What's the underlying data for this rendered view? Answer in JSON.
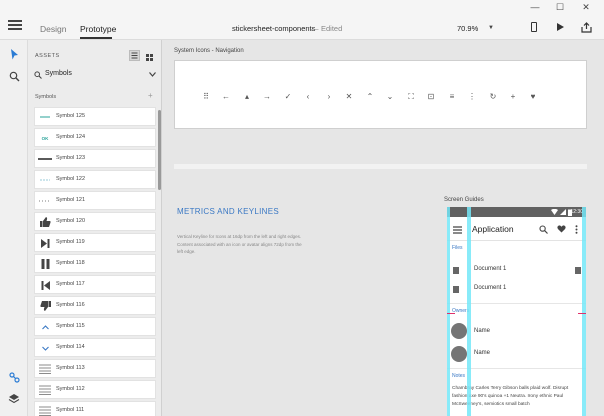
{
  "window": {
    "title": "stickersheet-components",
    "separator": "—",
    "status": "Edited",
    "zoom": "70.9%",
    "controls": {
      "minimize": "—",
      "maximize": "☐",
      "close": "✕"
    }
  },
  "modes": [
    "Design",
    "Prototype"
  ],
  "active_mode": "Prototype",
  "assets": {
    "title": "ASSETS",
    "filter": "Symbols",
    "section": "Symbols",
    "add": "+",
    "symbols": [
      {
        "label": "Symbol 125",
        "icon": "dash-line-icon"
      },
      {
        "label": "Symbol 124",
        "icon": "ok-text-icon"
      },
      {
        "label": "Symbol 123",
        "icon": "thick-line-icon"
      },
      {
        "label": "Symbol 122",
        "icon": "thin-dash-icon"
      },
      {
        "label": "Symbol 121",
        "icon": "dotted-arrows-icon"
      },
      {
        "label": "Symbol 120",
        "icon": "thumb-up-icon"
      },
      {
        "label": "Symbol 119",
        "icon": "skip-next-icon"
      },
      {
        "label": "Symbol 118",
        "icon": "pause-icon"
      },
      {
        "label": "Symbol 117",
        "icon": "skip-previous-icon"
      },
      {
        "label": "Symbol 116",
        "icon": "thumb-down-icon"
      },
      {
        "label": "Symbol 115",
        "icon": "chevron-up-icon"
      },
      {
        "label": "Symbol 114",
        "icon": "chevron-down-icon"
      },
      {
        "label": "Symbol 113",
        "icon": "menu-lines-icon"
      },
      {
        "label": "Symbol 112",
        "icon": "menu-lines-icon"
      },
      {
        "label": "Symbol 111",
        "icon": "menu-lines-icon"
      }
    ]
  },
  "canvas": {
    "nav_artboard_label": "System Icons - Navigation",
    "nav_icons": [
      {
        "name": "apps-grid-icon",
        "glyph": "⠿"
      },
      {
        "name": "arrow-back-icon",
        "glyph": "←"
      },
      {
        "name": "arrow-drop-up-icon",
        "glyph": "▴"
      },
      {
        "name": "arrow-forward-icon",
        "glyph": "→"
      },
      {
        "name": "check-icon",
        "glyph": "✓"
      },
      {
        "name": "chevron-left-icon",
        "glyph": "‹"
      },
      {
        "name": "chevron-right-icon",
        "glyph": "›"
      },
      {
        "name": "close-icon",
        "glyph": "✕"
      },
      {
        "name": "expand-less-icon",
        "glyph": "⌃"
      },
      {
        "name": "expand-more-icon",
        "glyph": "⌄"
      },
      {
        "name": "fullscreen-icon",
        "glyph": "⛶"
      },
      {
        "name": "fullscreen-exit-icon",
        "glyph": "⊡"
      },
      {
        "name": "menu-icon",
        "glyph": "≡"
      },
      {
        "name": "more-vert-icon",
        "glyph": "⋮"
      },
      {
        "name": "refresh-icon",
        "glyph": "↻"
      },
      {
        "name": "add-icon",
        "glyph": "+"
      },
      {
        "name": "favorite-icon",
        "glyph": "♥"
      }
    ],
    "metrics_heading": "METRICS AND KEYLINES",
    "metrics_body": "Vertical Keyline for Icons at 16dp from the left and right edges. Content associated with an icon or avatar aligns 72dp from the left edge.",
    "screen_guides_label": "Screen Guides"
  },
  "phone": {
    "time": "12:30",
    "app_title": "Application",
    "files_label": "Files",
    "documents": [
      "Document 1",
      "Document 1"
    ],
    "owners_label": "Owners",
    "names": [
      "Name",
      "Name"
    ],
    "notes_label": "Notes",
    "notes_text": "Chambray Carles Terry Gibson balls plaid wolf. Disrupt fashion axe 90's quinoa +1 Neutra. Irony ethnic Paul McSweeney's, semiotics small batch"
  },
  "colors": {
    "accent_blue": "#3a78c4",
    "guide_cyan": "#74e8f8",
    "keyline_pink": "#e0306a",
    "status_bar": "#616161"
  }
}
